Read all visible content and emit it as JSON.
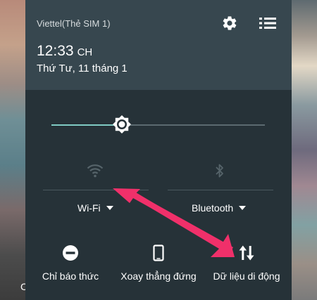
{
  "status": {
    "carrier": "Viettel(Thẻ SIM 1)",
    "time": "12:33",
    "ampm": "CH",
    "date": "Thứ Tư, 11 tháng 1"
  },
  "header_icons": [
    "gear-icon",
    "list-icon"
  ],
  "brightness": {
    "level": 0.33
  },
  "tiles": {
    "wifi": {
      "label": "Wi-Fi",
      "icon": "wifi-icon",
      "active": false
    },
    "bluetooth": {
      "label": "Bluetooth",
      "icon": "bluetooth-icon",
      "active": false
    }
  },
  "bottom_tiles": [
    {
      "label": "Chỉ báo thức",
      "icon": "do-not-disturb-icon"
    },
    {
      "label": "Xoay thẳng đứng",
      "icon": "phone-portrait-icon"
    },
    {
      "label": "Dữ liệu di động",
      "icon": "mobile-data-icon"
    }
  ],
  "wallpaper_partial_text": "C",
  "colors": {
    "panel_top": "#37474f",
    "panel_main": "#263238",
    "accent": "#80cbc4",
    "annotation_arrow": "#f0306a"
  }
}
